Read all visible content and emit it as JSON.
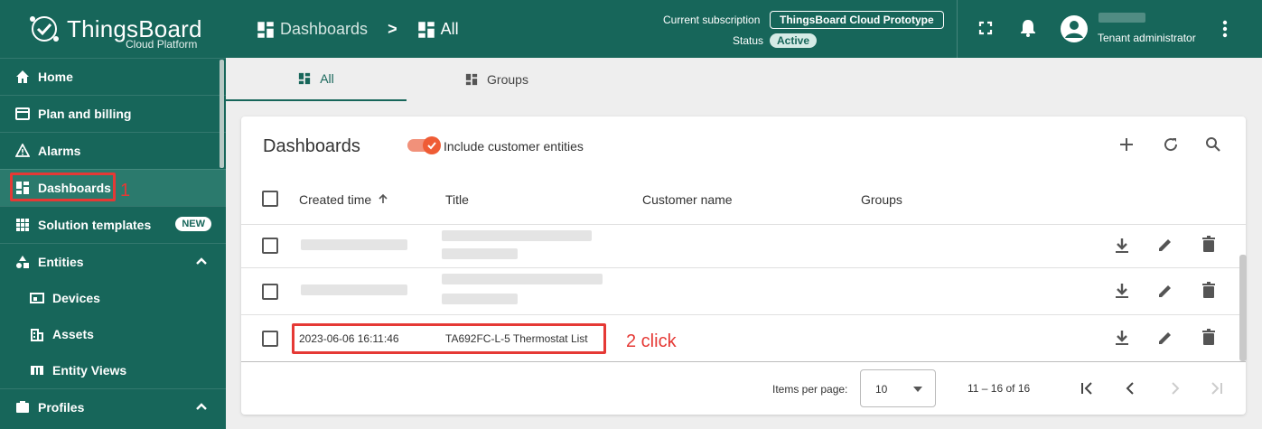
{
  "app": {
    "logo_title": "ThingsBoard",
    "logo_subtitle": "Cloud Platform"
  },
  "sidebar": {
    "items": [
      {
        "label": "Home",
        "icon": "home-icon"
      },
      {
        "label": "Plan and billing",
        "icon": "credit-card-icon"
      },
      {
        "label": "Alarms",
        "icon": "warning-icon"
      },
      {
        "label": "Dashboards",
        "icon": "dashboard-icon",
        "active": true
      },
      {
        "label": "Solution templates",
        "icon": "grid-icon",
        "badge": "NEW"
      },
      {
        "label": "Entities",
        "icon": "entities-icon"
      },
      {
        "label": "Devices",
        "icon": "devices-icon"
      },
      {
        "label": "Assets",
        "icon": "assets-icon"
      },
      {
        "label": "Entity Views",
        "icon": "entity-views-icon"
      },
      {
        "label": "Profiles",
        "icon": "profiles-icon"
      }
    ]
  },
  "header": {
    "breadcrumb_1": "Dashboards",
    "breadcrumb_sep": ">",
    "breadcrumb_2": "All",
    "subscription_label": "Current subscription",
    "subscription_value": "ThingsBoard Cloud Prototype",
    "status_label": "Status",
    "status_value": "Active",
    "user_role": "Tenant administrator"
  },
  "tabs": [
    {
      "label": "All"
    },
    {
      "label": "Groups"
    }
  ],
  "card": {
    "title": "Dashboards",
    "toggle_label": "Include customer entities",
    "columns": [
      "Created time",
      "Title",
      "Customer name",
      "Groups"
    ],
    "rows": [
      {
        "created": "",
        "title": ""
      },
      {
        "created": "",
        "title": ""
      },
      {
        "created": "2023-06-06 16:11:46",
        "title": "TA692FC-L-5 Thermostat List"
      }
    ]
  },
  "pager": {
    "items_label": "Items per page:",
    "page_size": "10",
    "range": "11 – 16 of 16"
  },
  "annotations": {
    "step1": "1",
    "step2": "2 click"
  },
  "colors": {
    "primary": "#17665a",
    "accent": "#ef5c35",
    "annotation": "#e53935"
  }
}
